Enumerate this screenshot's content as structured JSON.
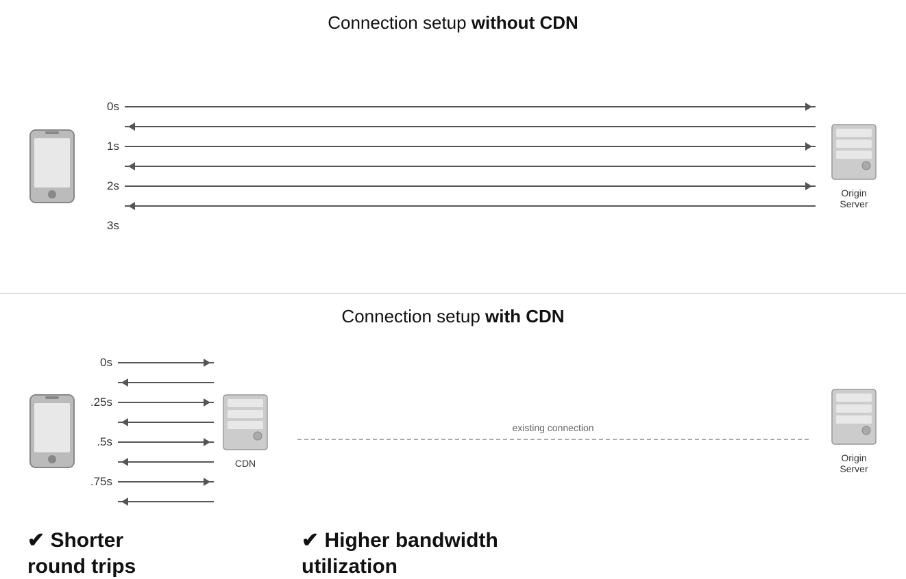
{
  "top": {
    "title_normal": "Connection setup ",
    "title_bold": "without CDN",
    "time_labels": [
      "0s",
      "1s",
      "2s",
      "3s"
    ],
    "arrows": [
      "right",
      "left",
      "right",
      "left",
      "right",
      "left"
    ],
    "server_label": "Origin\nServer"
  },
  "bottom": {
    "title_normal": "Connection setup ",
    "title_bold": "with CDN",
    "time_labels": [
      "0s",
      ".25s",
      ".5s",
      ".75s"
    ],
    "cdn_label": "CDN",
    "existing_conn": "existing connection",
    "server_label": "Origin\nServer",
    "benefit_left": "✔ Shorter\nround trips",
    "benefit_right": "✔ Higher bandwidth\nutilization"
  }
}
